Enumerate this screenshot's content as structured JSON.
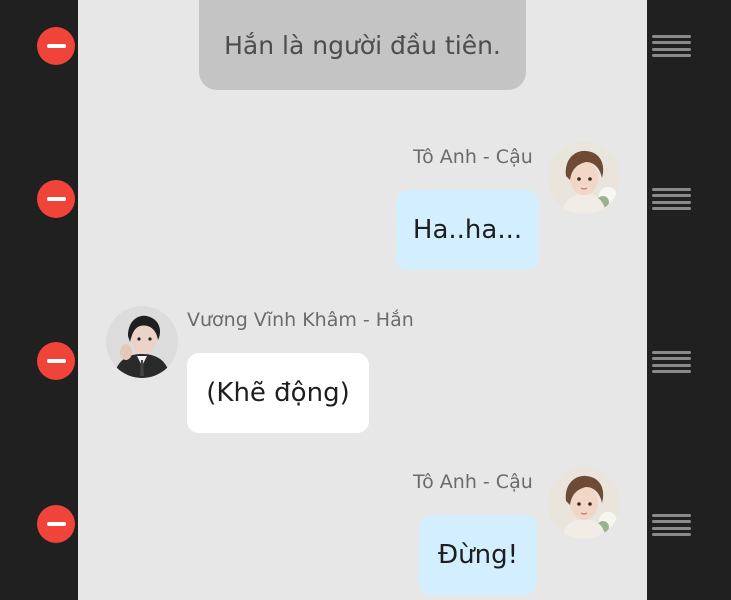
{
  "narration": {
    "text": "Hắn là người đầu tiên."
  },
  "messages": [
    {
      "side": "right",
      "sender": "Tô Anh - Cậu",
      "text": "Ha..ha...",
      "avatar": "character-avatar-to-anh"
    },
    {
      "side": "left",
      "sender": "Vương Vĩnh Khâm - Hắn",
      "text": "(Khẽ động)",
      "avatar": "character-avatar-vuong-vinh-kham"
    },
    {
      "side": "right",
      "sender": "Tô Anh - Cậu",
      "text": "Đừng!",
      "avatar": "character-avatar-to-anh"
    }
  ],
  "row_controls": {
    "delete_icon": "minus-circle-icon",
    "reorder_icon": "drag-handle-icon",
    "colors": {
      "delete": "#f0443b",
      "handle": "#8a8a8a"
    }
  },
  "colors": {
    "chat_background": "#e7e7e7",
    "rail_background": "#202020",
    "narration_bubble": "#c4c4c4",
    "right_bubble": "#d3efff",
    "left_bubble": "#ffffff"
  }
}
